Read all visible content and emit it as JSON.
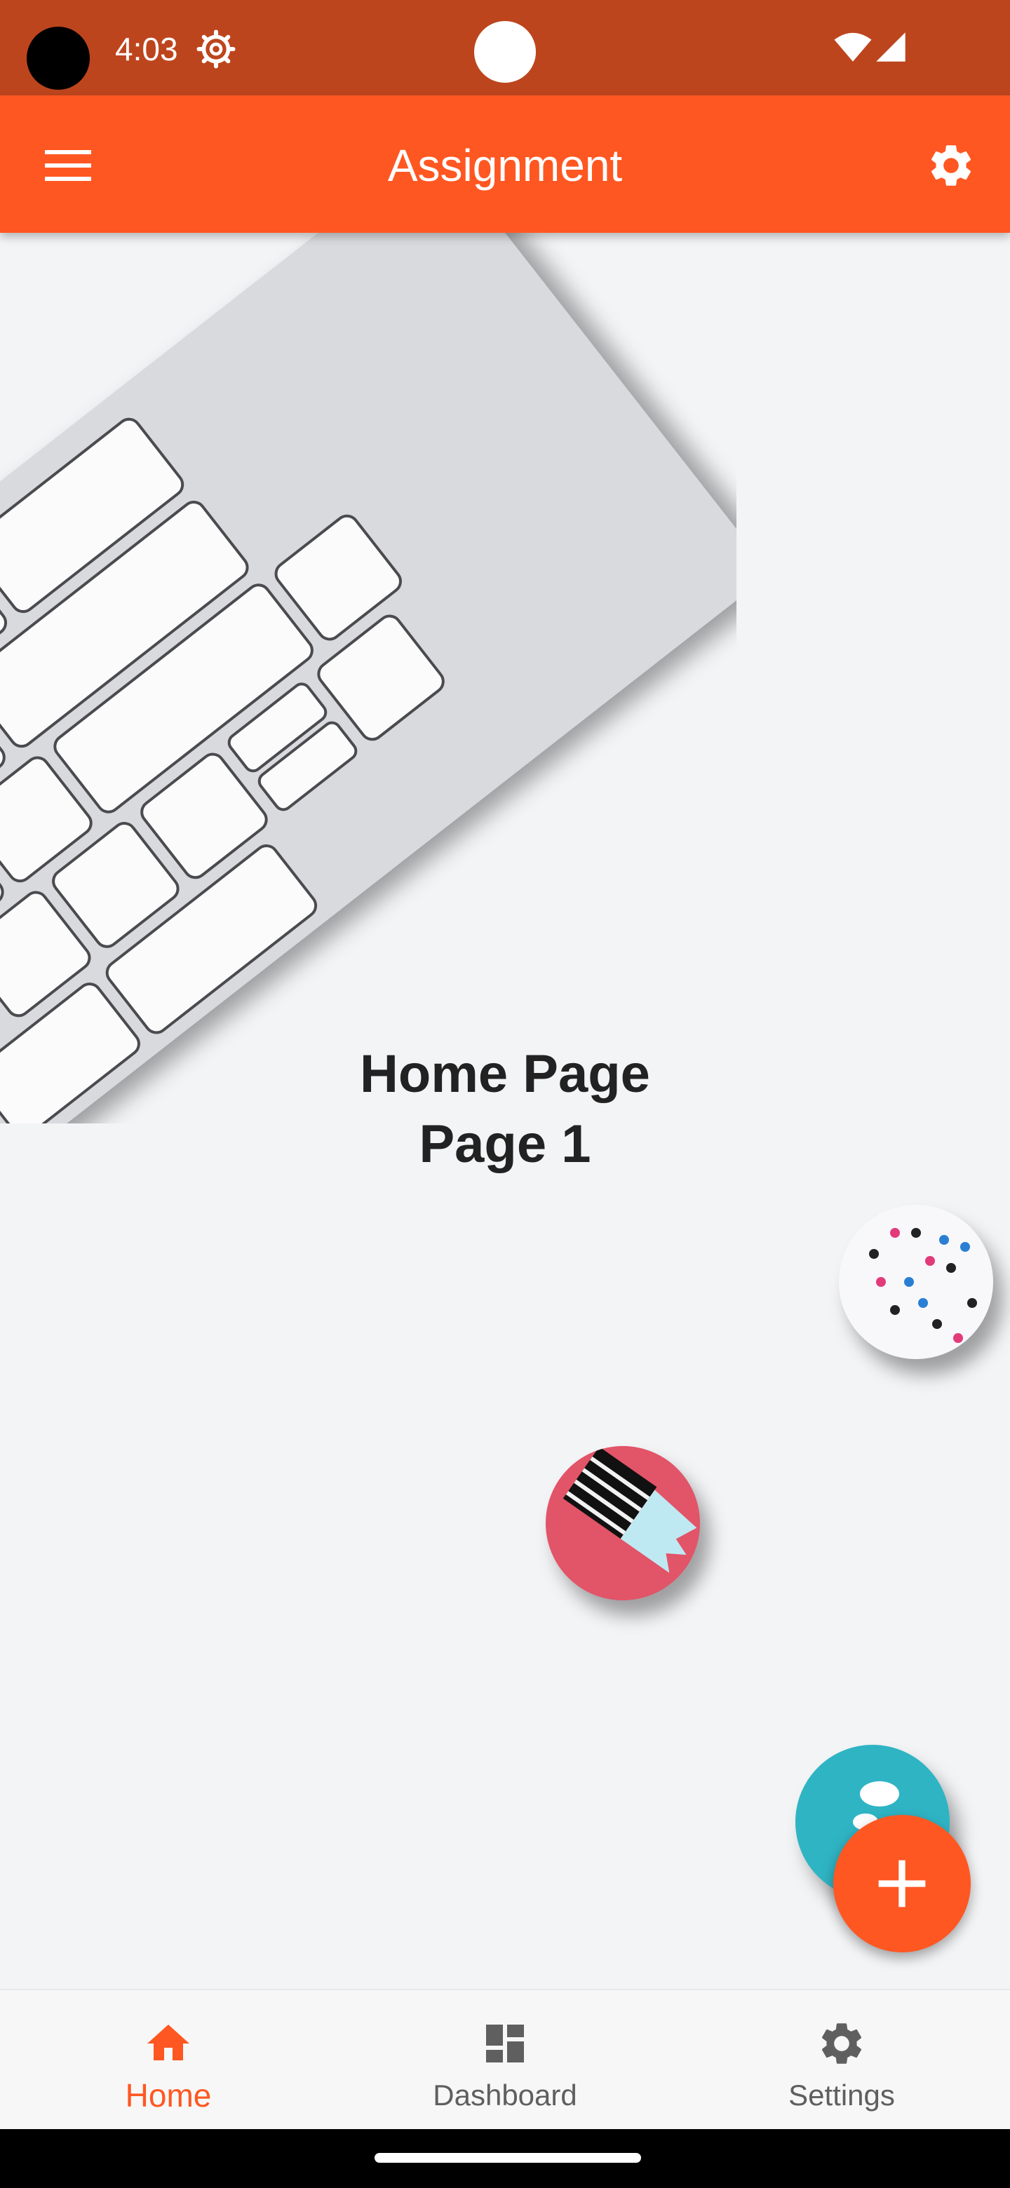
{
  "status_bar": {
    "time": "4:03",
    "icons": [
      "settings-gear-icon",
      "wifi-icon",
      "cell-signal-icon"
    ]
  },
  "app_bar": {
    "title": "Assignment",
    "left_icon": "menu-icon",
    "right_icon": "gear-icon",
    "color": "#FF5722"
  },
  "main": {
    "heading_line1": "Home Page",
    "heading_line2": "Page 1"
  },
  "fab": {
    "icon": "plus-icon",
    "color": "#FF5722"
  },
  "bottom_nav": {
    "items": [
      {
        "label": "Home",
        "icon": "home-icon",
        "active": true
      },
      {
        "label": "Dashboard",
        "icon": "dashboard-icon",
        "active": false
      },
      {
        "label": "Settings",
        "icon": "gear-icon",
        "active": false
      }
    ],
    "active_color": "#FF5722",
    "inactive_color": "#5f5f5f"
  }
}
